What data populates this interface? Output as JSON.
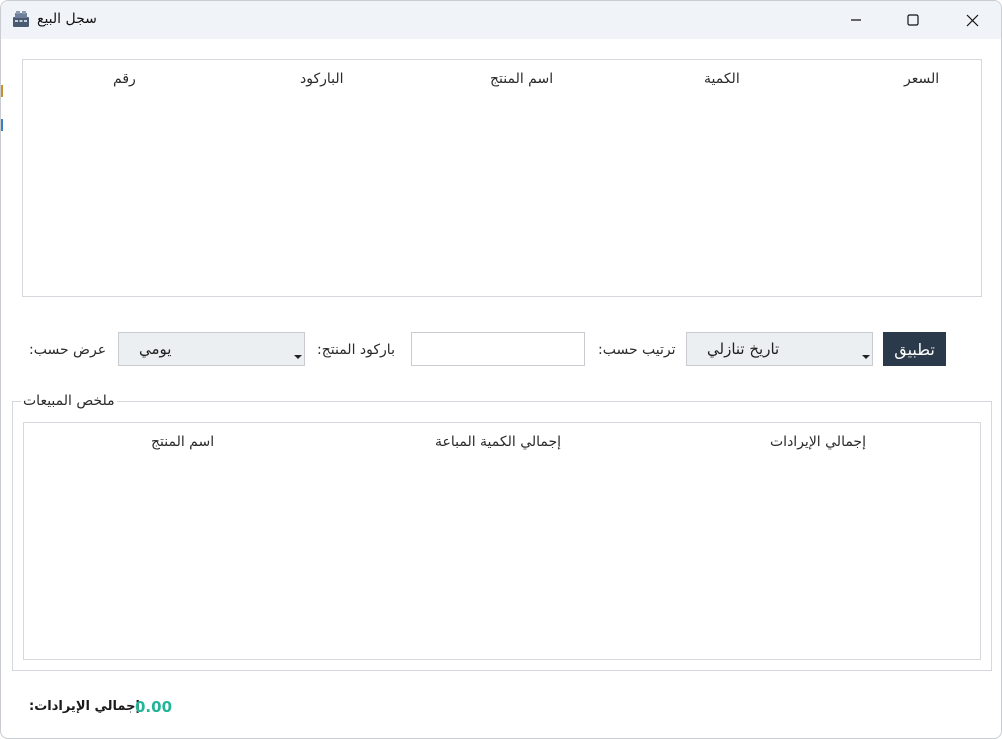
{
  "window": {
    "title": "سجل البيع",
    "app_icon": "app-icon"
  },
  "sales_table": {
    "columns": [
      "رقم",
      "الباركود",
      "اسم المنتج",
      "الكمية",
      "السعر"
    ],
    "rows": []
  },
  "filters": {
    "view_by_label": ":عرض حسب",
    "view_by_value": "يومي",
    "barcode_label": ":باركود المنتج",
    "barcode_value": "",
    "sort_by_label": ":ترتيب حسب",
    "sort_by_value": "تاريخ تنازلي",
    "apply_label": "تطبيق"
  },
  "summary": {
    "group_title": "ملخص المبيعات",
    "columns": [
      "اسم المنتج",
      "إجمالي الكمية المباعة",
      "إجمالي الإيرادات"
    ],
    "rows": []
  },
  "footer": {
    "total_revenue_label": ":إجمالي الإيرادات",
    "total_revenue_value": "0.00"
  },
  "colors": {
    "titlebar": "#f0f4f9",
    "apply_button": "#2b3a4a",
    "total_value": "#22b59a"
  }
}
